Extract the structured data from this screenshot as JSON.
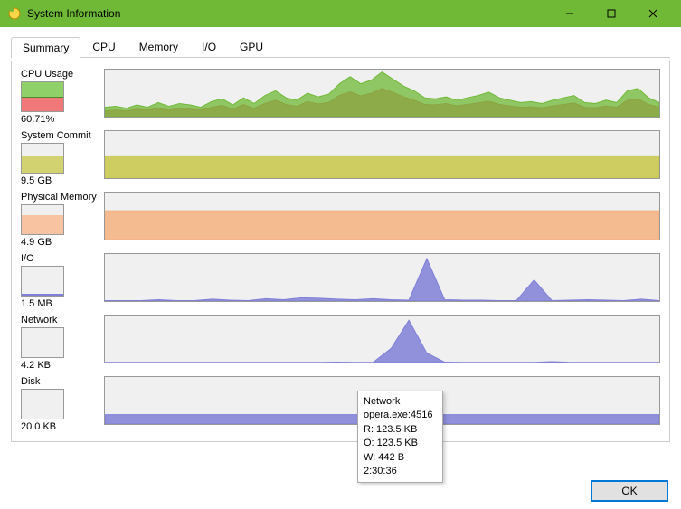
{
  "window": {
    "title": "System Information"
  },
  "tabs": {
    "summary": "Summary",
    "cpu": "CPU",
    "memory": "Memory",
    "io": "I/O",
    "gpu": "GPU"
  },
  "metrics": {
    "cpu": {
      "label": "CPU Usage",
      "value": "60.71%"
    },
    "commit": {
      "label": "System Commit",
      "value": "9.5 GB"
    },
    "physmem": {
      "label": "Physical Memory",
      "value": "4.9 GB"
    },
    "io": {
      "label": "I/O",
      "value": "1.5 MB"
    },
    "network": {
      "label": "Network",
      "value": "4.2 KB"
    },
    "disk": {
      "label": "Disk",
      "value": "20.0 KB"
    }
  },
  "tooltip": {
    "line1": "Network",
    "line2": "opera.exe:4516",
    "line3": "R: 123.5 KB",
    "line4": "O: 123.5 KB",
    "line5": "W: 442 B",
    "line6": "2:30:36"
  },
  "footer": {
    "ok": "OK"
  },
  "chart_data": [
    {
      "name": "CPU Usage",
      "type": "area_stacked",
      "ylim": [
        0,
        100
      ],
      "series": [
        {
          "name": "green",
          "color": "#6fb936",
          "values": [
            20,
            22,
            18,
            25,
            20,
            30,
            22,
            28,
            25,
            20,
            32,
            38,
            25,
            40,
            28,
            45,
            55,
            40,
            35,
            50,
            42,
            48,
            70,
            85,
            70,
            78,
            95,
            80,
            65,
            55,
            40,
            38,
            42,
            35,
            40,
            45,
            52,
            40,
            35,
            30,
            32,
            28,
            35,
            40,
            45,
            30,
            28,
            35,
            30,
            55,
            60,
            40,
            30
          ]
        },
        {
          "name": "red",
          "color": "#e16060",
          "values": [
            12,
            14,
            12,
            16,
            14,
            18,
            14,
            18,
            16,
            14,
            20,
            24,
            16,
            26,
            18,
            28,
            35,
            26,
            22,
            32,
            27,
            30,
            45,
            53,
            44,
            50,
            60,
            52,
            42,
            35,
            26,
            25,
            28,
            23,
            26,
            29,
            33,
            26,
            23,
            20,
            21,
            19,
            23,
            26,
            29,
            20,
            19,
            23,
            20,
            35,
            38,
            26,
            20
          ]
        }
      ]
    },
    {
      "name": "System Commit",
      "type": "area",
      "ylim": [
        0,
        20
      ],
      "series": [
        {
          "name": "commit",
          "color": "#c7c748",
          "values": [
            9.5,
            9.5,
            9.5,
            9.5,
            9.5,
            9.5,
            9.5,
            9.5,
            9.5,
            9.5,
            9.5,
            9.5,
            9.5,
            9.5
          ]
        }
      ]
    },
    {
      "name": "Physical Memory",
      "type": "area",
      "ylim": [
        0,
        8
      ],
      "series": [
        {
          "name": "phys",
          "color": "#f5b07f",
          "values": [
            4.9,
            4.9,
            4.9,
            4.9,
            4.9,
            4.9,
            4.9,
            4.9,
            4.9,
            4.9,
            4.9,
            4.9,
            4.9,
            4.9
          ]
        }
      ]
    },
    {
      "name": "I/O",
      "type": "area",
      "ylim": [
        0,
        10
      ],
      "series": [
        {
          "name": "io",
          "color": "#7f7fd7",
          "values": [
            0.1,
            0.1,
            0.1,
            0.3,
            0.1,
            0.1,
            0.4,
            0.2,
            0.1,
            0.5,
            0.3,
            0.7,
            0.6,
            0.4,
            0.3,
            0.5,
            0.3,
            0.2,
            9,
            0.3,
            0.2,
            0.2,
            0.1,
            0.1,
            4.5,
            0.1,
            0.2,
            0.3,
            0.2,
            0.1,
            0.4,
            0.1
          ]
        }
      ]
    },
    {
      "name": "Network",
      "type": "area",
      "ylim": [
        0,
        10
      ],
      "series": [
        {
          "name": "net",
          "color": "#7f7fd7",
          "values": [
            0.05,
            0.05,
            0.05,
            0.05,
            0.05,
            0.05,
            0.05,
            0.05,
            0.05,
            0.05,
            0.05,
            0.05,
            0.05,
            0.1,
            0.05,
            0.05,
            3,
            9,
            2,
            0.1,
            0.05,
            0.05,
            0.05,
            0.05,
            0.05,
            0.2,
            0.05,
            0.05,
            0.05,
            0.05,
            0.05,
            0.05
          ]
        }
      ]
    },
    {
      "name": "Disk",
      "type": "area",
      "ylim": [
        0,
        100
      ],
      "series": [
        {
          "name": "disk",
          "color": "#7f7fd7",
          "values": [
            20,
            20,
            20,
            20,
            20,
            20,
            20,
            20,
            20,
            20,
            20,
            20,
            20,
            20
          ]
        }
      ]
    }
  ]
}
